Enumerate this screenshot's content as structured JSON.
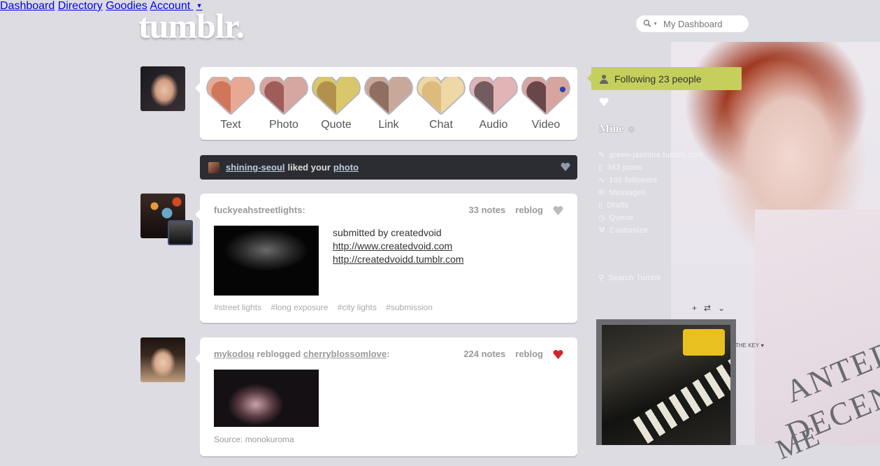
{
  "brand": {
    "logo": "tumblr."
  },
  "nav": {
    "dashboard": "Dashboard",
    "directory": "Directory",
    "goodies": "Goodies",
    "account": "Account"
  },
  "search": {
    "placeholder": "My Dashboard"
  },
  "post_types": [
    {
      "label": "Text"
    },
    {
      "label": "Photo"
    },
    {
      "label": "Quote"
    },
    {
      "label": "Link"
    },
    {
      "label": "Chat"
    },
    {
      "label": "Audio"
    },
    {
      "label": "Video"
    }
  ],
  "notification": {
    "user": "shining-seoul",
    "text": "liked your",
    "object": "photo"
  },
  "posts": [
    {
      "author": "fuckyeahstreetlights:",
      "notes": "33 notes",
      "reblog": "reblog",
      "body": {
        "line1": "submitted by createdvoid",
        "link1": "http://www.createdvoid.com",
        "link2": "http://createdvoidd.tumblr.com"
      },
      "tags": [
        "#street lights",
        "#long exposure",
        "#city lights",
        "#submission"
      ]
    },
    {
      "author": "mykodou",
      "action": "reblogged",
      "source_user": "cherryblossomlove",
      "colon": ":",
      "notes": "224 notes",
      "reblog": "reblog",
      "source": "Source: monokuroma"
    }
  ],
  "sidebar": {
    "following": "Following 23 people",
    "mine_title": "Mine",
    "items": [
      "green-jasmine.tumblr.com",
      "343 posts",
      "101 followers",
      "Messages",
      "Drafts",
      "Queue",
      "Customize"
    ],
    "search": "Search Tumblr",
    "the_key": "THE KEY"
  },
  "bg_text": {
    "line1": "ANTED",
    "line2": "DECENT",
    "line3": "ME"
  },
  "colors": {
    "background": "#dcdce2",
    "following_bar": "#c5cf5c",
    "notification_bg": "#2c2d32",
    "liked_heart": "#d0262d"
  }
}
